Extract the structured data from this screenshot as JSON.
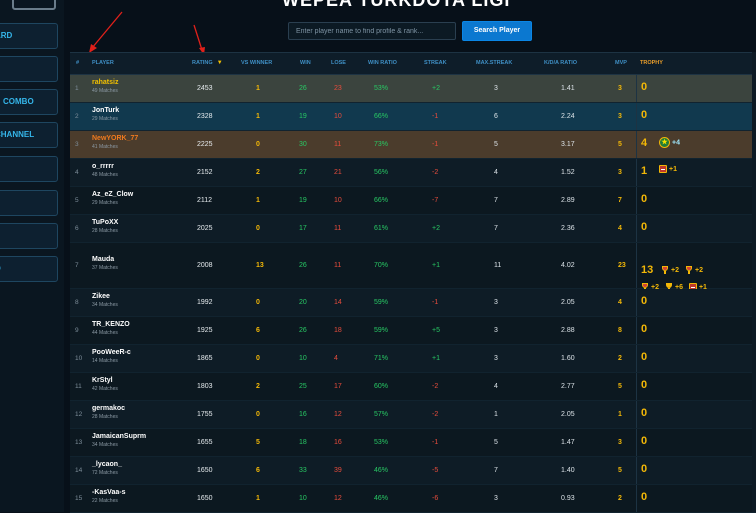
{
  "header": {
    "title": "WEPEA TURKDOTA LIGI",
    "search_placeholder": "Enter player name to find profile & rank...",
    "search_button": "Search Player"
  },
  "sidebar": {
    "items": [
      {
        "label": "ARD"
      },
      {
        "label": ""
      },
      {
        "label": "COMBO"
      },
      {
        "label": "CHANNEL"
      },
      {
        "label": ""
      },
      {
        "label": ""
      },
      {
        "label": ""
      },
      {
        "label": "D"
      }
    ]
  },
  "colors": {
    "accent": "#0b78d0",
    "gold": "#f2b707",
    "win": "#28c864",
    "lose": "#e74c3c",
    "header_text": "#3f8fc4"
  },
  "table": {
    "columns": [
      "#",
      "PLAYER",
      "RATING",
      "VS WINNER",
      "WIN",
      "LOSE",
      "WIN RATIO",
      "STREAK",
      "MAX.STREAK",
      "K/D/A RATIO",
      "MVP",
      "TROPHY"
    ],
    "sort_indicator": "▼",
    "rows": [
      {
        "rank": "1",
        "name": "rahatsiz",
        "matches": "49 Matches",
        "rating": "2453",
        "vs": "1",
        "win": "26",
        "lose": "23",
        "ratio": "53%",
        "streak": "+2",
        "max": "3",
        "kda": "1.41",
        "mvp": "3",
        "trophy": "0",
        "badges": []
      },
      {
        "rank": "2",
        "name": "JonTurk",
        "matches": "29 Matches",
        "rating": "2328",
        "vs": "1",
        "win": "19",
        "lose": "10",
        "ratio": "66%",
        "streak": "-1",
        "max": "6",
        "kda": "2.24",
        "mvp": "3",
        "trophy": "0",
        "badges": []
      },
      {
        "rank": "3",
        "name": "NewYORK_77",
        "matches": "41 Matches",
        "rating": "2225",
        "vs": "0",
        "win": "30",
        "lose": "11",
        "ratio": "73%",
        "streak": "-1",
        "max": "5",
        "kda": "3.17",
        "mvp": "5",
        "trophy": "4",
        "badges": [
          {
            "icon": "star-medal-icon",
            "text": "+4"
          }
        ]
      },
      {
        "rank": "4",
        "name": "o_rrrrr",
        "matches": "48 Matches",
        "rating": "2152",
        "vs": "2",
        "win": "27",
        "lose": "21",
        "ratio": "56%",
        "streak": "-2",
        "max": "4",
        "kda": "1.52",
        "mvp": "3",
        "trophy": "1",
        "badges": [
          {
            "icon": "calendar-icon",
            "text": "+1"
          }
        ]
      },
      {
        "rank": "5",
        "name": "Az_eZ_Clow",
        "matches": "29 Matches",
        "rating": "2112",
        "vs": "1",
        "win": "19",
        "lose": "10",
        "ratio": "66%",
        "streak": "-7",
        "max": "7",
        "kda": "2.89",
        "mvp": "7",
        "trophy": "0",
        "badges": []
      },
      {
        "rank": "6",
        "name": "TuPoXX",
        "matches": "28 Matches",
        "rating": "2025",
        "vs": "0",
        "win": "17",
        "lose": "11",
        "ratio": "61%",
        "streak": "+2",
        "max": "7",
        "kda": "2.36",
        "mvp": "4",
        "trophy": "0",
        "badges": []
      },
      {
        "rank": "7",
        "name": "Mauda",
        "matches": "37 Matches",
        "rating": "2008",
        "vs": "13",
        "win": "26",
        "lose": "11",
        "ratio": "70%",
        "streak": "+1",
        "max": "11",
        "kda": "4.02",
        "mvp": "23",
        "trophy": "13",
        "badges": [
          {
            "icon": "red-trophy-icon",
            "text": "+2"
          },
          {
            "icon": "red-trophy-icon",
            "text": "+2"
          },
          {
            "icon": "red-trophy-icon",
            "text": "+2"
          },
          {
            "icon": "trophy-icon",
            "text": "+6"
          },
          {
            "icon": "calendar-icon",
            "text": "+1"
          }
        ]
      },
      {
        "rank": "8",
        "name": "Zikee",
        "matches": "34 Matches",
        "rating": "1992",
        "vs": "0",
        "win": "20",
        "lose": "14",
        "ratio": "59%",
        "streak": "-1",
        "max": "3",
        "kda": "2.05",
        "mvp": "4",
        "trophy": "0",
        "badges": []
      },
      {
        "rank": "9",
        "name": "TR_KENZO",
        "matches": "44 Matches",
        "rating": "1925",
        "vs": "6",
        "win": "26",
        "lose": "18",
        "ratio": "59%",
        "streak": "+5",
        "max": "3",
        "kda": "2.88",
        "mvp": "8",
        "trophy": "0",
        "badges": []
      },
      {
        "rank": "10",
        "name": "PooWeeR-c",
        "matches": "14 Matches",
        "rating": "1865",
        "vs": "0",
        "win": "10",
        "lose": "4",
        "ratio": "71%",
        "streak": "+1",
        "max": "3",
        "kda": "1.60",
        "mvp": "2",
        "trophy": "0",
        "badges": []
      },
      {
        "rank": "11",
        "name": "KrStyl",
        "matches": "42 Matches",
        "rating": "1803",
        "vs": "2",
        "win": "25",
        "lose": "17",
        "ratio": "60%",
        "streak": "-2",
        "max": "4",
        "kda": "2.77",
        "mvp": "5",
        "trophy": "0",
        "badges": []
      },
      {
        "rank": "12",
        "name": "germakoc",
        "matches": "28 Matches",
        "rating": "1755",
        "vs": "0",
        "win": "16",
        "lose": "12",
        "ratio": "57%",
        "streak": "-2",
        "max": "1",
        "kda": "2.05",
        "mvp": "1",
        "trophy": "0",
        "badges": []
      },
      {
        "rank": "13",
        "name": "JamaicanSuprm",
        "matches": "34 Matches",
        "rating": "1655",
        "vs": "5",
        "win": "18",
        "lose": "16",
        "ratio": "53%",
        "streak": "-1",
        "max": "5",
        "kda": "1.47",
        "mvp": "3",
        "trophy": "0",
        "badges": []
      },
      {
        "rank": "14",
        "name": "_lycaon_",
        "matches": "72 Matches",
        "rating": "1650",
        "vs": "6",
        "win": "33",
        "lose": "39",
        "ratio": "46%",
        "streak": "-5",
        "max": "7",
        "kda": "1.40",
        "mvp": "5",
        "trophy": "0",
        "badges": []
      },
      {
        "rank": "15",
        "name": "-KasVaa-s",
        "matches": "22 Matches",
        "rating": "1650",
        "vs": "1",
        "win": "10",
        "lose": "12",
        "ratio": "46%",
        "streak": "-6",
        "max": "3",
        "kda": "0.93",
        "mvp": "2",
        "trophy": "0",
        "badges": []
      }
    ]
  }
}
